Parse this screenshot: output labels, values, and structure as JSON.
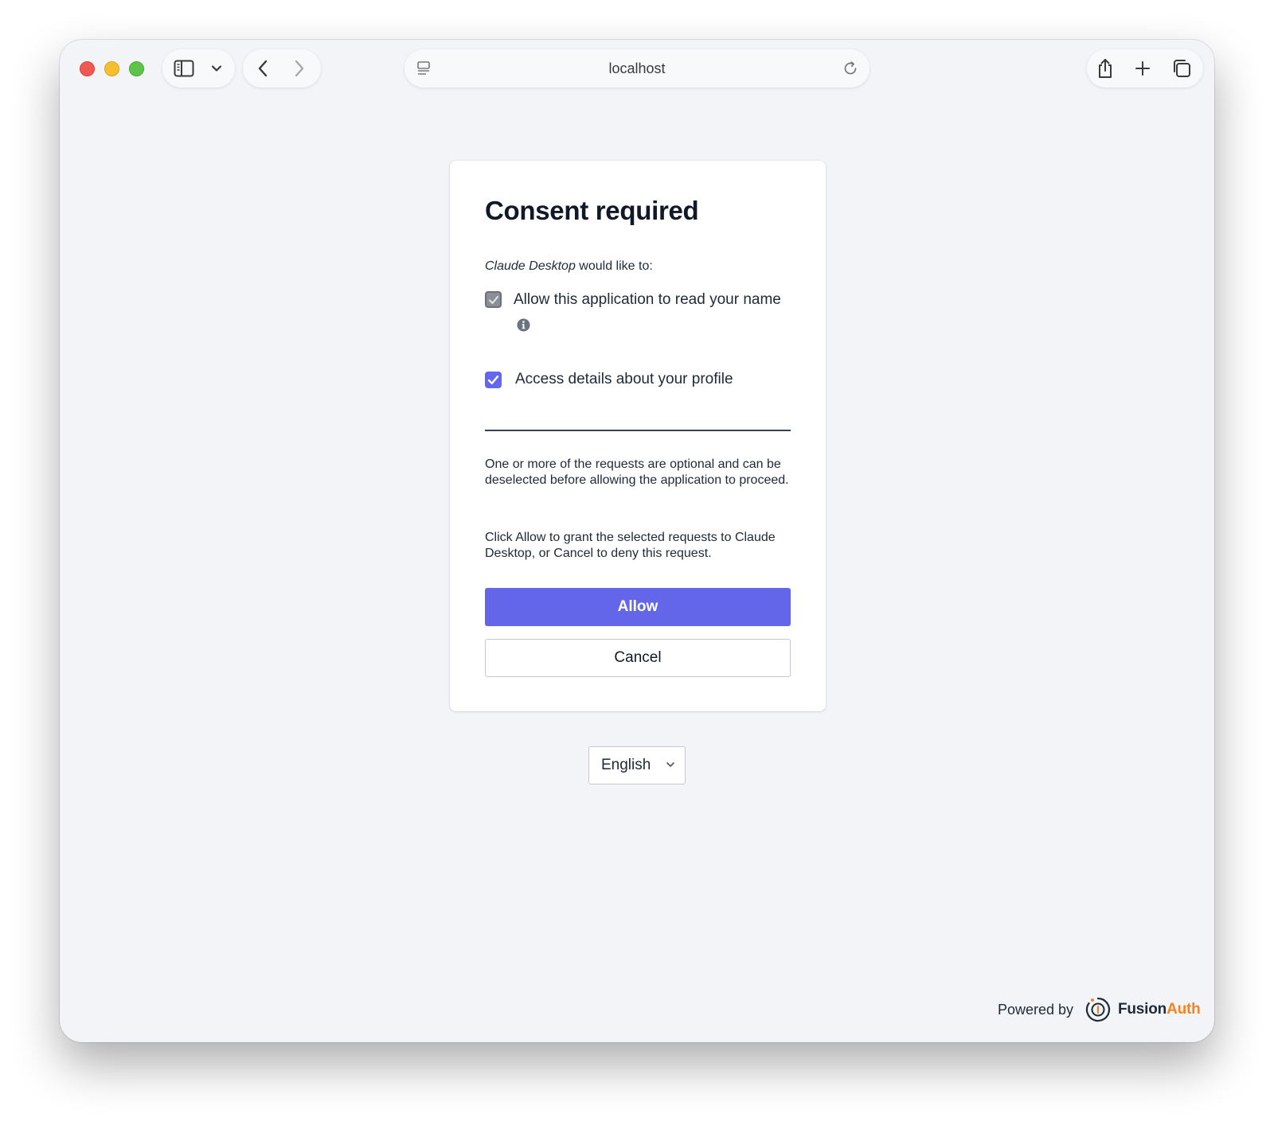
{
  "browser": {
    "url": "localhost"
  },
  "consent": {
    "title": "Consent required",
    "app_name": "Claude Desktop",
    "intro_suffix": " would like to:",
    "permissions": [
      {
        "label": "Allow this application to read your name",
        "checked": true,
        "disabled": true
      },
      {
        "label": "Access details about your profile",
        "checked": true,
        "disabled": false
      }
    ],
    "optional_note": "One or more of the requests are optional and can be deselected before allowing the application to proceed.",
    "instructions": "Click Allow to grant the selected requests to Claude Desktop, or Cancel to deny this request.",
    "allow_label": "Allow",
    "cancel_label": "Cancel"
  },
  "language": {
    "selected": "English"
  },
  "footer": {
    "powered_by": "Powered by",
    "brand_part1": "Fusion",
    "brand_part2": "Auth"
  },
  "colors": {
    "accent": "#6366e9",
    "brand_orange": "#f58320",
    "page_background": "#f2f4f7"
  },
  "icons": {
    "sidebar": "sidebar-toggle-icon",
    "back": "chevron-left-icon",
    "forward": "chevron-right-icon",
    "reader": "reader-mode-icon",
    "reload": "reload-icon",
    "share": "share-icon",
    "new_tab": "plus-icon",
    "tabs": "tab-overview-icon",
    "info": "info-icon",
    "check": "checkmark-icon",
    "select": "chevron-down-icon",
    "brand": "fusionauth-logo-icon"
  }
}
